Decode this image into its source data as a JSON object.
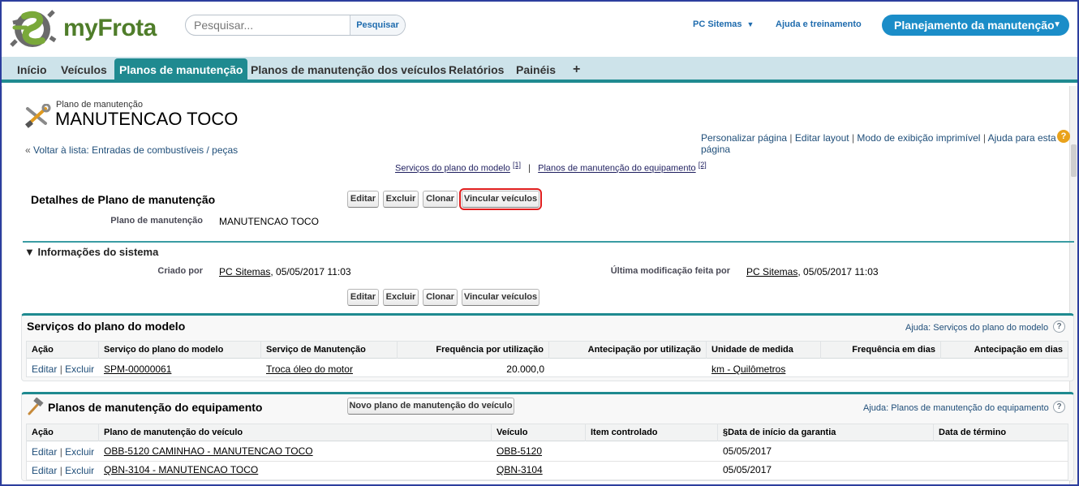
{
  "header": {
    "logo_text": "myFrota",
    "search": {
      "placeholder": "Pesquisar...",
      "button": "Pesquisar"
    },
    "user": "PC Sitemas",
    "help": "Ajuda e treinamento",
    "app": "Planejamento da manutenção"
  },
  "tabs": [
    {
      "label": "Início"
    },
    {
      "label": "Veículos"
    },
    {
      "label": "Planos de manutenção"
    },
    {
      "label": "Planos de manutenção dos veículos"
    },
    {
      "label": "Relatórios"
    },
    {
      "label": "Painéis"
    },
    {
      "label": "+"
    }
  ],
  "active_tab": "Planos de manutenção",
  "record": {
    "type": "Plano de manutenção",
    "name": "MANUTENCAO TOCO"
  },
  "page_links": {
    "customize": "Personalizar página",
    "edit_layout": "Editar layout",
    "printable": "Modo de exibição imprimível",
    "help": "Ajuda para esta página",
    "sep": "|"
  },
  "back": {
    "arrow": "«",
    "label": "Voltar à lista: Entradas de combustíveis / peças"
  },
  "related_links": {
    "first": "Serviços do plano do modelo",
    "first_count": "[1]",
    "sep": "|",
    "second": "Planos de manutenção do equipamento",
    "second_count": "[2]"
  },
  "detail": {
    "title": "Detalhes de Plano de manutenção",
    "buttons": [
      "Editar",
      "Excluir",
      "Clonar",
      "Vincular veículos"
    ],
    "field_label": "Plano de manutenção",
    "field_value": "MANUTENCAO TOCO"
  },
  "system_info": {
    "title": "Informações do sistema",
    "created_label": "Criado por",
    "created_user": "PC Sitemas",
    "created_date": ", 05/05/2017 11:03",
    "modified_label": "Última modificação feita por",
    "modified_user": "PC Sitemas",
    "modified_date": ", 05/05/2017 11:03"
  },
  "services": {
    "title": "Serviços do plano do modelo",
    "help": "Ajuda: Serviços do plano do modelo",
    "columns": [
      "Ação",
      "Serviço do plano do modelo",
      "Serviço de Manutenção",
      "Frequência por utilização",
      "Antecipação por utilização",
      "Unidade de medida",
      "Frequência em dias",
      "Antecipação em dias"
    ],
    "rows": [
      {
        "edit": "Editar",
        "sep": "|",
        "delete": "Excluir",
        "service": "SPM-00000061",
        "maintenance": "Troca óleo do motor",
        "frequency": "20.000,0",
        "anticipation": "",
        "unit": "km - Quilômetros",
        "freq_days": "",
        "ant_days": ""
      }
    ]
  },
  "equipment": {
    "title": "Planos de manutenção do equipamento",
    "new_button": "Novo plano de manutenção do veículo",
    "help": "Ajuda: Planos de manutenção do equipamento",
    "columns": [
      "Ação",
      "Plano de manutenção do veículo",
      "Veículo",
      "Item controlado",
      "§Data de início da garantia",
      "Data de término"
    ],
    "rows": [
      {
        "edit": "Editar",
        "sep": "|",
        "delete": "Excluir",
        "plan": "OBB-5120 CAMINHAO - MANUTENCAO TOCO",
        "vehicle": "OBB-5120",
        "item": "",
        "start": "05/05/2017",
        "end": ""
      },
      {
        "edit": "Editar",
        "sep": "|",
        "delete": "Excluir",
        "plan": "QBN-3104 - MANUTENCAO TOCO",
        "vehicle": "QBN-3104",
        "item": "",
        "start": "05/05/2017",
        "end": ""
      }
    ]
  },
  "colors": {
    "accent": "#1f8a90",
    "app_button": "#1b8dc8",
    "highlight": "#e01e1e",
    "tabbar": "#cde3ea"
  }
}
